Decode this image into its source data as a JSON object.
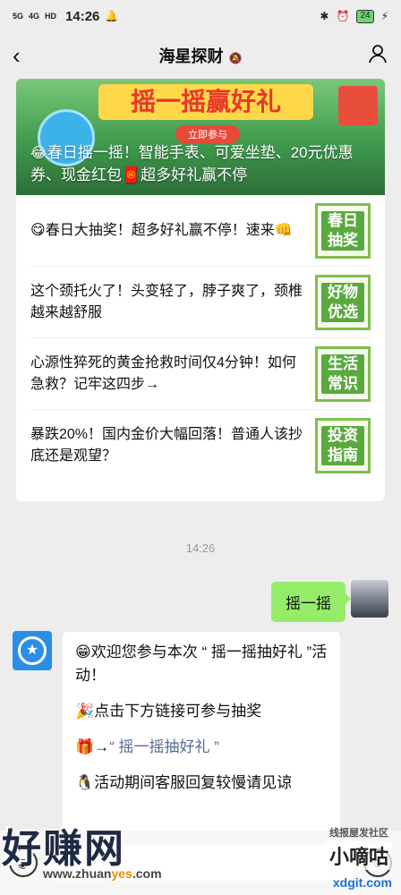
{
  "status_bar": {
    "signal_1": "5G",
    "signal_2": "4G",
    "hd": "HD",
    "time": "14:26",
    "battery": "24"
  },
  "header": {
    "back_icon": "chevron-left-icon",
    "title": "海星探财",
    "mute_icon": "bell-muted-icon",
    "profile_icon": "person-icon"
  },
  "article_card": {
    "banner": {
      "headline": "摇一摇赢好礼",
      "join_label": "立即参与",
      "caption_icon": "😂",
      "caption": "春日摇一摇！智能手表、可爱坐垫、20元优惠券、现金红包🧧超多好礼赢不停"
    },
    "items": [
      {
        "icon": "😋",
        "title": "春日大抽奖！超多好礼赢不停！速来👊",
        "thumb": "春日抽奖"
      },
      {
        "title": "这个颈托火了！头变轻了，脖子爽了，颈椎越来越舒服",
        "thumb": "好物优选"
      },
      {
        "title": "心源性猝死的黄金抢救时间仅4分钟！如何急救？记牢这四步→",
        "thumb": "生活常识"
      },
      {
        "title": "暴跌20%！国内金价大幅回落！普通人该抄底还是观望？",
        "thumb": "投资指南"
      }
    ]
  },
  "chat": {
    "timestamp": "14:26",
    "outgoing_message": "摇一摇",
    "incoming": {
      "line1": "😁欢迎您参与本次 “ 摇一摇抽好礼 ”活动！",
      "line2": "🎉点击下方链接可参与抽奖",
      "line3_prefix": "🎁→",
      "line3_link": "“ 摇一摇抽好礼 ”",
      "line4": "🐧活动期间客服回复较慢请见谅"
    }
  },
  "watermarks": {
    "left_big": "好赚网",
    "left_url_a": "www.zhuan",
    "left_url_b": "yes",
    "left_url_c": ".com",
    "right_small": "线报屋发社区",
    "right_big": "小嘀咕",
    "right_url": "xdgit.com"
  },
  "colors": {
    "outgoing_bubble": "#95ec69",
    "link": "#576b95",
    "thumb_green": "#5aa93e"
  }
}
